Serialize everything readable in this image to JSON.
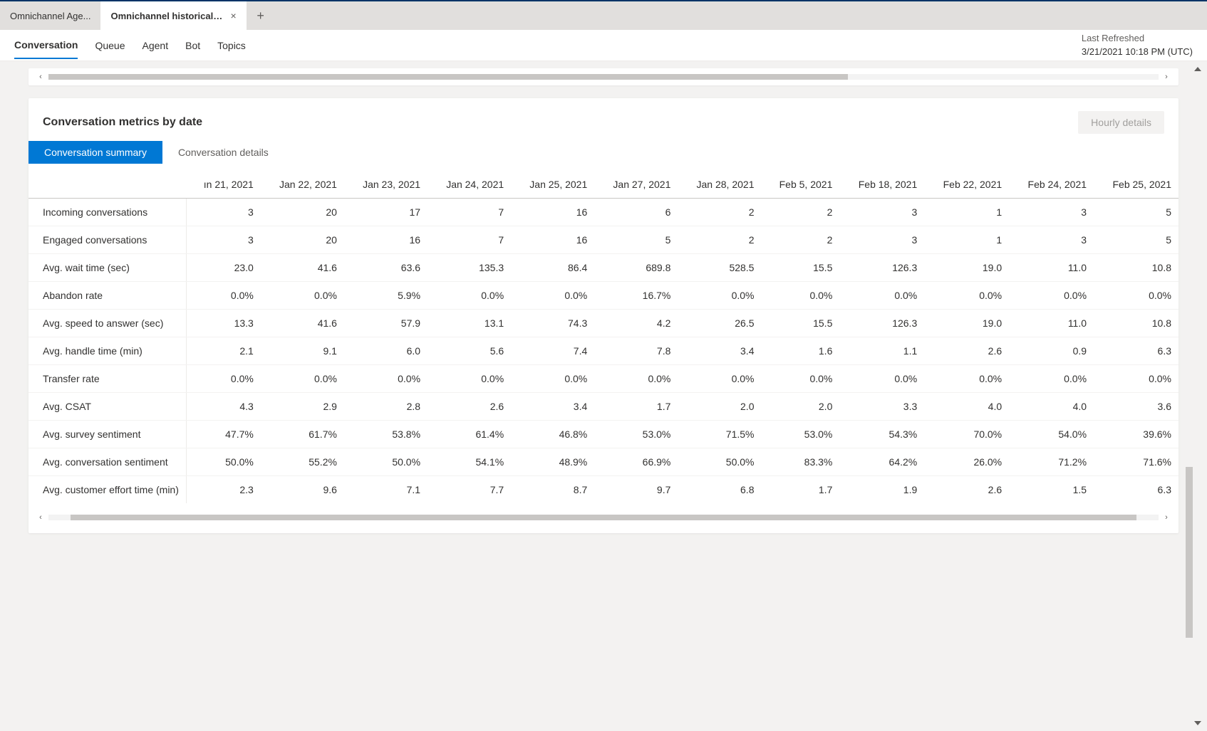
{
  "tabs": {
    "inactive_label": "Omnichannel Age...",
    "active_label": "Omnichannel historical an...",
    "close_glyph": "×",
    "plus_glyph": "+"
  },
  "nav": {
    "items": [
      "Conversation",
      "Queue",
      "Agent",
      "Bot",
      "Topics"
    ],
    "active_index": 0
  },
  "refresh": {
    "label": "Last Refreshed",
    "timestamp": "3/21/2021 10:18 PM (UTC)"
  },
  "card": {
    "title": "Conversation metrics by date",
    "hourly_button": "Hourly details",
    "inner_tabs": [
      "Conversation summary",
      "Conversation details"
    ],
    "inner_active_index": 0
  },
  "chart_data": {
    "type": "table",
    "columns": [
      "ın 21, 2021",
      "Jan 22, 2021",
      "Jan 23, 2021",
      "Jan 24, 2021",
      "Jan 25, 2021",
      "Jan 27, 2021",
      "Jan 28, 2021",
      "Feb 5, 2021",
      "Feb 18, 2021",
      "Feb 22, 2021",
      "Feb 24, 2021",
      "Feb 25, 2021"
    ],
    "rows": [
      {
        "label": "Incoming conversations",
        "values": [
          "3",
          "20",
          "17",
          "7",
          "16",
          "6",
          "2",
          "2",
          "3",
          "1",
          "3",
          "5"
        ]
      },
      {
        "label": "Engaged conversations",
        "values": [
          "3",
          "20",
          "16",
          "7",
          "16",
          "5",
          "2",
          "2",
          "3",
          "1",
          "3",
          "5"
        ]
      },
      {
        "label": "Avg. wait time (sec)",
        "values": [
          "23.0",
          "41.6",
          "63.6",
          "135.3",
          "86.4",
          "689.8",
          "528.5",
          "15.5",
          "126.3",
          "19.0",
          "11.0",
          "10.8"
        ]
      },
      {
        "label": "Abandon rate",
        "values": [
          "0.0%",
          "0.0%",
          "5.9%",
          "0.0%",
          "0.0%",
          "16.7%",
          "0.0%",
          "0.0%",
          "0.0%",
          "0.0%",
          "0.0%",
          "0.0%"
        ]
      },
      {
        "label": "Avg. speed to answer (sec)",
        "values": [
          "13.3",
          "41.6",
          "57.9",
          "13.1",
          "74.3",
          "4.2",
          "26.5",
          "15.5",
          "126.3",
          "19.0",
          "11.0",
          "10.8"
        ]
      },
      {
        "label": "Avg. handle time (min)",
        "values": [
          "2.1",
          "9.1",
          "6.0",
          "5.6",
          "7.4",
          "7.8",
          "3.4",
          "1.6",
          "1.1",
          "2.6",
          "0.9",
          "6.3"
        ]
      },
      {
        "label": "Transfer rate",
        "values": [
          "0.0%",
          "0.0%",
          "0.0%",
          "0.0%",
          "0.0%",
          "0.0%",
          "0.0%",
          "0.0%",
          "0.0%",
          "0.0%",
          "0.0%",
          "0.0%"
        ]
      },
      {
        "label": "Avg. CSAT",
        "values": [
          "4.3",
          "2.9",
          "2.8",
          "2.6",
          "3.4",
          "1.7",
          "2.0",
          "2.0",
          "3.3",
          "4.0",
          "4.0",
          "3.6"
        ]
      },
      {
        "label": "Avg. survey sentiment",
        "values": [
          "47.7%",
          "61.7%",
          "53.8%",
          "61.4%",
          "46.8%",
          "53.0%",
          "71.5%",
          "53.0%",
          "54.3%",
          "70.0%",
          "54.0%",
          "39.6%"
        ]
      },
      {
        "label": "Avg. conversation sentiment",
        "values": [
          "50.0%",
          "55.2%",
          "50.0%",
          "54.1%",
          "48.9%",
          "66.9%",
          "50.0%",
          "83.3%",
          "64.2%",
          "26.0%",
          "71.2%",
          "71.6%"
        ]
      },
      {
        "label": "Avg. customer effort time (min)",
        "values": [
          "2.3",
          "9.6",
          "7.1",
          "7.7",
          "8.7",
          "9.7",
          "6.8",
          "1.7",
          "1.9",
          "2.6",
          "1.5",
          "6.3"
        ]
      }
    ]
  },
  "scroll_glyphs": {
    "left": "‹",
    "right": "›"
  }
}
